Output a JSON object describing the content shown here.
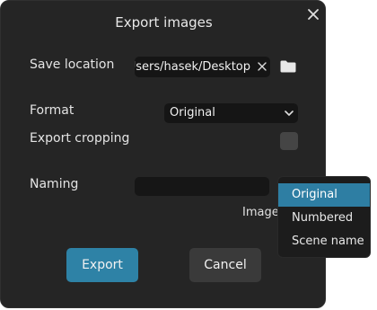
{
  "dialog": {
    "title": "Export images"
  },
  "save_location": {
    "label": "Save location",
    "path": "C:/Users/hasek/Desktop"
  },
  "format": {
    "label": "Format",
    "selected": "Original"
  },
  "export_cropping": {
    "label": "Export cropping",
    "checked": false
  },
  "naming": {
    "label": "Naming",
    "value": "",
    "preview": "Image.",
    "options": [
      "Original",
      "Numbered",
      "Scene name"
    ],
    "selected_option": "Original"
  },
  "buttons": {
    "export": "Export",
    "cancel": "Cancel"
  },
  "icons": {
    "close": "close-icon",
    "clear": "clear-icon",
    "folder": "folder-icon",
    "dropdown": "chevron-down-icon"
  },
  "colors": {
    "dialog_bg": "#252525",
    "field_bg": "#151515",
    "accent": "#2e82a6",
    "selection": "#2e7ea3"
  }
}
